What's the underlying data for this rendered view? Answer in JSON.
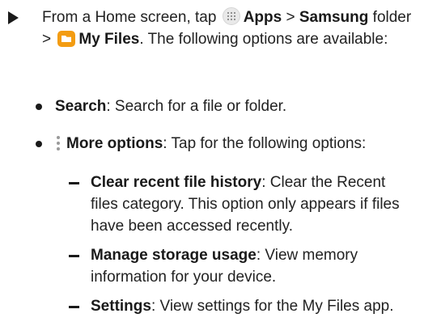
{
  "intro": {
    "prefix": "From a Home screen, tap",
    "apps_label": "Apps",
    "sep1": " > ",
    "samsung_label": "Samsung",
    "folder_text": " folder > ",
    "myfiles_label": "My Files",
    "suffix": ". The following options are available:"
  },
  "items": [
    {
      "label": "Search",
      "desc": ": Search for a file or folder."
    },
    {
      "label": "More options",
      "desc": ": Tap for the following options:"
    }
  ],
  "subitems": [
    {
      "label": "Clear recent file history",
      "desc": ": Clear the Recent files category. This option only appears if files have been accessed recently."
    },
    {
      "label": "Manage storage usage",
      "desc": ": View memory information for your device."
    },
    {
      "label": "Settings",
      "desc": ": View settings for the My Files app."
    }
  ],
  "icons": {
    "apps": "apps-grid-icon",
    "folder": "my-files-folder-icon",
    "more": "more-options-icon"
  },
  "colors": {
    "text": "#222222",
    "folder_orange": "#f39c12"
  }
}
